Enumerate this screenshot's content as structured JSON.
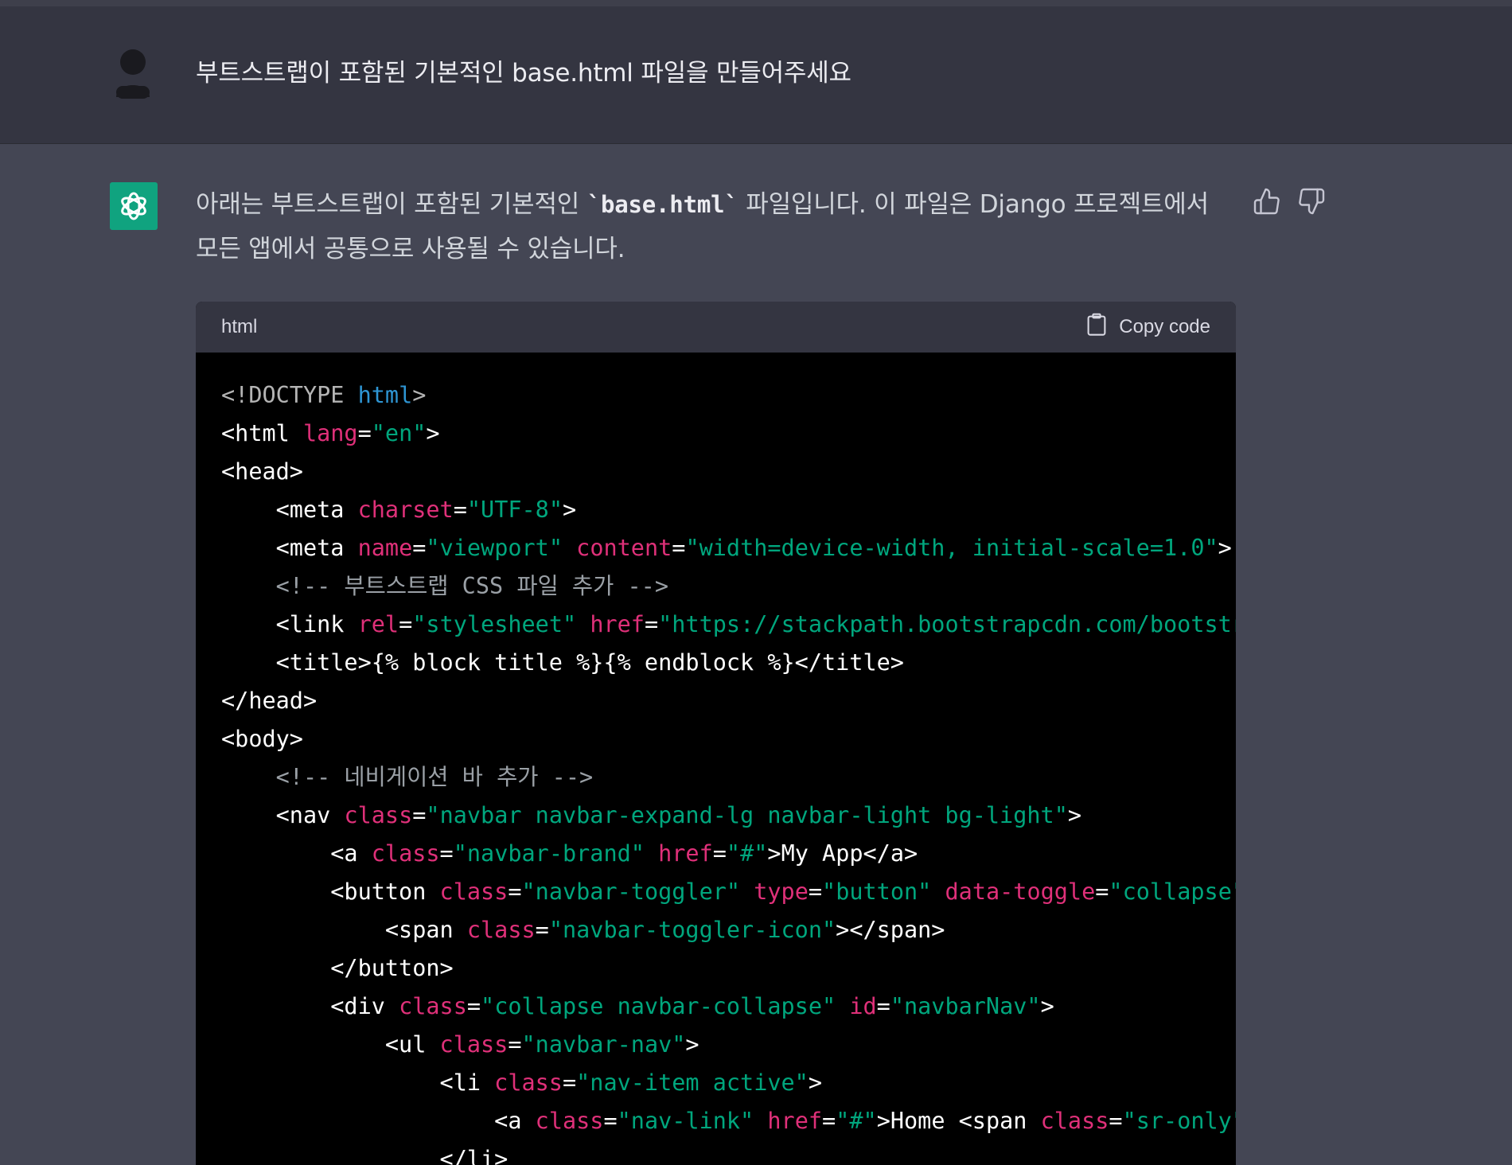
{
  "user_message": {
    "text": "부트스트랩이 포함된 기본적인 base.html 파일을 만들어주세요"
  },
  "assistant_message": {
    "text_before": "아래는 부트스트랩이 포함된 기본적인 ",
    "inline_code": "`base.html`",
    "text_after": " 파일입니다. 이 파일은 Django 프로젝트에서 모든 앱에서 공통으로 사용될 수 있습니다."
  },
  "code_block": {
    "language": "html",
    "copy_label": "Copy code",
    "lines": [
      [
        {
          "t": "doctype",
          "v": "<!DOCTYPE "
        },
        {
          "t": "keyword",
          "v": "html"
        },
        {
          "t": "doctype",
          "v": ">"
        }
      ],
      [
        {
          "t": "text",
          "v": "<html "
        },
        {
          "t": "attr",
          "v": "lang"
        },
        {
          "t": "text",
          "v": "="
        },
        {
          "t": "str",
          "v": "\"en\""
        },
        {
          "t": "text",
          "v": ">"
        }
      ],
      [
        {
          "t": "text",
          "v": "<head>"
        }
      ],
      [
        {
          "t": "text",
          "v": "    <meta "
        },
        {
          "t": "attr",
          "v": "charset"
        },
        {
          "t": "text",
          "v": "="
        },
        {
          "t": "str",
          "v": "\"UTF-8\""
        },
        {
          "t": "text",
          "v": ">"
        }
      ],
      [
        {
          "t": "text",
          "v": "    <meta "
        },
        {
          "t": "attr",
          "v": "name"
        },
        {
          "t": "text",
          "v": "="
        },
        {
          "t": "str",
          "v": "\"viewport\""
        },
        {
          "t": "text",
          "v": " "
        },
        {
          "t": "attr",
          "v": "content"
        },
        {
          "t": "text",
          "v": "="
        },
        {
          "t": "str",
          "v": "\"width=device-width, initial-scale=1.0\""
        },
        {
          "t": "text",
          "v": ">"
        }
      ],
      [
        {
          "t": "comment",
          "v": "    <!-- 부트스트랩 CSS 파일 추가 -->"
        }
      ],
      [
        {
          "t": "text",
          "v": "    <link "
        },
        {
          "t": "attr",
          "v": "rel"
        },
        {
          "t": "text",
          "v": "="
        },
        {
          "t": "str",
          "v": "\"stylesheet\""
        },
        {
          "t": "text",
          "v": " "
        },
        {
          "t": "attr",
          "v": "href"
        },
        {
          "t": "text",
          "v": "="
        },
        {
          "t": "str",
          "v": "\"https://stackpath.bootstrapcdn.com/bootstra"
        }
      ],
      [
        {
          "t": "text",
          "v": "    <title>{% block title %}{% endblock %}</title>"
        }
      ],
      [
        {
          "t": "text",
          "v": "</head>"
        }
      ],
      [
        {
          "t": "text",
          "v": "<body>"
        }
      ],
      [
        {
          "t": "comment",
          "v": "    <!-- 네비게이션 바 추가 -->"
        }
      ],
      [
        {
          "t": "text",
          "v": "    <nav "
        },
        {
          "t": "attr",
          "v": "class"
        },
        {
          "t": "text",
          "v": "="
        },
        {
          "t": "str",
          "v": "\"navbar navbar-expand-lg navbar-light bg-light\""
        },
        {
          "t": "text",
          "v": ">"
        }
      ],
      [
        {
          "t": "text",
          "v": "        <a "
        },
        {
          "t": "attr",
          "v": "class"
        },
        {
          "t": "text",
          "v": "="
        },
        {
          "t": "str",
          "v": "\"navbar-brand\""
        },
        {
          "t": "text",
          "v": " "
        },
        {
          "t": "attr",
          "v": "href"
        },
        {
          "t": "text",
          "v": "="
        },
        {
          "t": "str",
          "v": "\"#\""
        },
        {
          "t": "text",
          "v": ">My App</a>"
        }
      ],
      [
        {
          "t": "text",
          "v": "        <button "
        },
        {
          "t": "attr",
          "v": "class"
        },
        {
          "t": "text",
          "v": "="
        },
        {
          "t": "str",
          "v": "\"navbar-toggler\""
        },
        {
          "t": "text",
          "v": " "
        },
        {
          "t": "attr",
          "v": "type"
        },
        {
          "t": "text",
          "v": "="
        },
        {
          "t": "str",
          "v": "\"button\""
        },
        {
          "t": "text",
          "v": " "
        },
        {
          "t": "attr",
          "v": "data-toggle"
        },
        {
          "t": "text",
          "v": "="
        },
        {
          "t": "str",
          "v": "\"collapse\""
        }
      ],
      [
        {
          "t": "text",
          "v": "            <span "
        },
        {
          "t": "attr",
          "v": "class"
        },
        {
          "t": "text",
          "v": "="
        },
        {
          "t": "str",
          "v": "\"navbar-toggler-icon\""
        },
        {
          "t": "text",
          "v": "></span>"
        }
      ],
      [
        {
          "t": "text",
          "v": "        </button>"
        }
      ],
      [
        {
          "t": "text",
          "v": "        <div "
        },
        {
          "t": "attr",
          "v": "class"
        },
        {
          "t": "text",
          "v": "="
        },
        {
          "t": "str",
          "v": "\"collapse navbar-collapse\""
        },
        {
          "t": "text",
          "v": " "
        },
        {
          "t": "attr",
          "v": "id"
        },
        {
          "t": "text",
          "v": "="
        },
        {
          "t": "str",
          "v": "\"navbarNav\""
        },
        {
          "t": "text",
          "v": ">"
        }
      ],
      [
        {
          "t": "text",
          "v": "            <ul "
        },
        {
          "t": "attr",
          "v": "class"
        },
        {
          "t": "text",
          "v": "="
        },
        {
          "t": "str",
          "v": "\"navbar-nav\""
        },
        {
          "t": "text",
          "v": ">"
        }
      ],
      [
        {
          "t": "text",
          "v": "                <li "
        },
        {
          "t": "attr",
          "v": "class"
        },
        {
          "t": "text",
          "v": "="
        },
        {
          "t": "str",
          "v": "\"nav-item active\""
        },
        {
          "t": "text",
          "v": ">"
        }
      ],
      [
        {
          "t": "text",
          "v": "                    <a "
        },
        {
          "t": "attr",
          "v": "class"
        },
        {
          "t": "text",
          "v": "="
        },
        {
          "t": "str",
          "v": "\"nav-link\""
        },
        {
          "t": "text",
          "v": " "
        },
        {
          "t": "attr",
          "v": "href"
        },
        {
          "t": "text",
          "v": "="
        },
        {
          "t": "str",
          "v": "\"#\""
        },
        {
          "t": "text",
          "v": ">Home <span "
        },
        {
          "t": "attr",
          "v": "class"
        },
        {
          "t": "text",
          "v": "="
        },
        {
          "t": "str",
          "v": "\"sr-only\""
        },
        {
          "t": "text",
          "v": ">"
        }
      ],
      [
        {
          "t": "text",
          "v": "                </li>"
        }
      ]
    ]
  },
  "icons": {
    "user_avatar": "user-avatar-icon",
    "assistant_logo": "openai-logo-icon",
    "copy": "clipboard-icon",
    "thumbs_up": "thumbs-up-icon",
    "thumbs_down": "thumbs-down-icon"
  },
  "colors": {
    "background": "#444654",
    "user_row": "#343541",
    "logo_bg": "#10a37f",
    "code_bg": "#000000",
    "code_header_bg": "#343541",
    "attr": "#df3079",
    "string": "#00a67d",
    "keyword": "#2e95d3",
    "comment": "#9aa0a6"
  }
}
